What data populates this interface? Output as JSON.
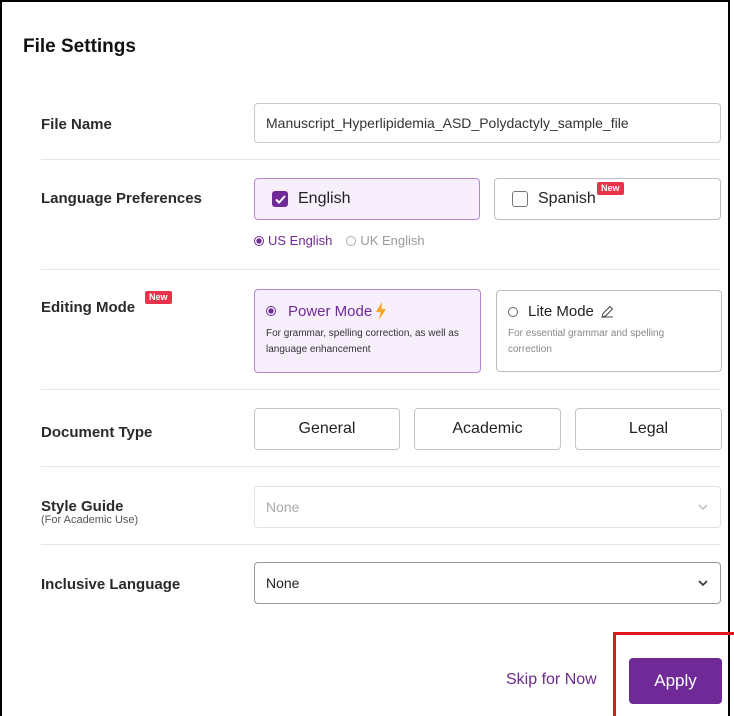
{
  "title": "File Settings",
  "colors": {
    "accent": "#6f2a97",
    "new_badge": "#e8334a",
    "highlight": "#e3141a"
  },
  "file_name": {
    "label": "File Name",
    "value": "Manuscript_Hyperlipidemia_ASD_Polydactyly_sample_file"
  },
  "language": {
    "label": "Language Preferences",
    "options": [
      {
        "label": "English",
        "checked": true
      },
      {
        "label": "Spanish",
        "checked": false,
        "badge": "New"
      }
    ],
    "variants": [
      {
        "label": "US English",
        "selected": true
      },
      {
        "label": "UK English",
        "selected": false
      }
    ]
  },
  "editing_mode": {
    "label": "Editing Mode",
    "badge": "New",
    "modes": [
      {
        "title": "Power Mode",
        "desc": "For grammar, spelling correction, as well as language enhancement",
        "selected": true,
        "icon": "lightning-icon"
      },
      {
        "title": "Lite Mode",
        "desc": "For essential grammar and spelling correction",
        "selected": false,
        "icon": "pencil-icon"
      }
    ]
  },
  "document_type": {
    "label": "Document Type",
    "options": [
      "General",
      "Academic",
      "Legal"
    ]
  },
  "style_guide": {
    "label": "Style Guide",
    "sublabel": "(For Academic Use)",
    "value": "None",
    "disabled": true
  },
  "inclusive_language": {
    "label": "Inclusive Language",
    "value": "None"
  },
  "footer": {
    "skip_label": "Skip for Now",
    "apply_label": "Apply"
  }
}
